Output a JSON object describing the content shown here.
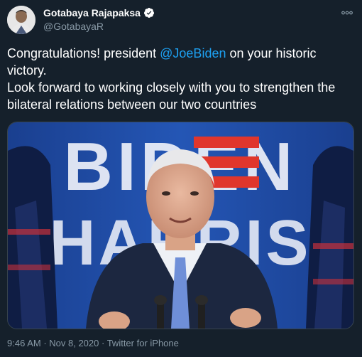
{
  "author": {
    "display_name": "Gotabaya Rajapaksa",
    "handle": "@GotabayaR",
    "avatar_icon": "profile-avatar",
    "verified_icon": "verified-badge-icon"
  },
  "tweet": {
    "text_before_mention": "Congratulations! president ",
    "mention": "@JoeBiden",
    "text_after_mention": " on your historic victory.\nLook forward to working closely with you to strengthen the bilateral relations between our two countries",
    "image": {
      "banner_text_top": "BIDEN",
      "banner_text_bottom": "HARRIS"
    }
  },
  "meta": {
    "time": "9:46 AM",
    "separator": " · ",
    "date": "Nov 8, 2020",
    "source": "Twitter for iPhone"
  },
  "colors": {
    "background": "#15202b",
    "text_primary": "#ffffff",
    "text_secondary": "#8899a6",
    "link": "#1da1f2",
    "verified": "#ffffff",
    "banner_blue": "#1f4fa6",
    "banner_red": "#e0362c"
  },
  "icons": {
    "more": "more-options-icon"
  }
}
